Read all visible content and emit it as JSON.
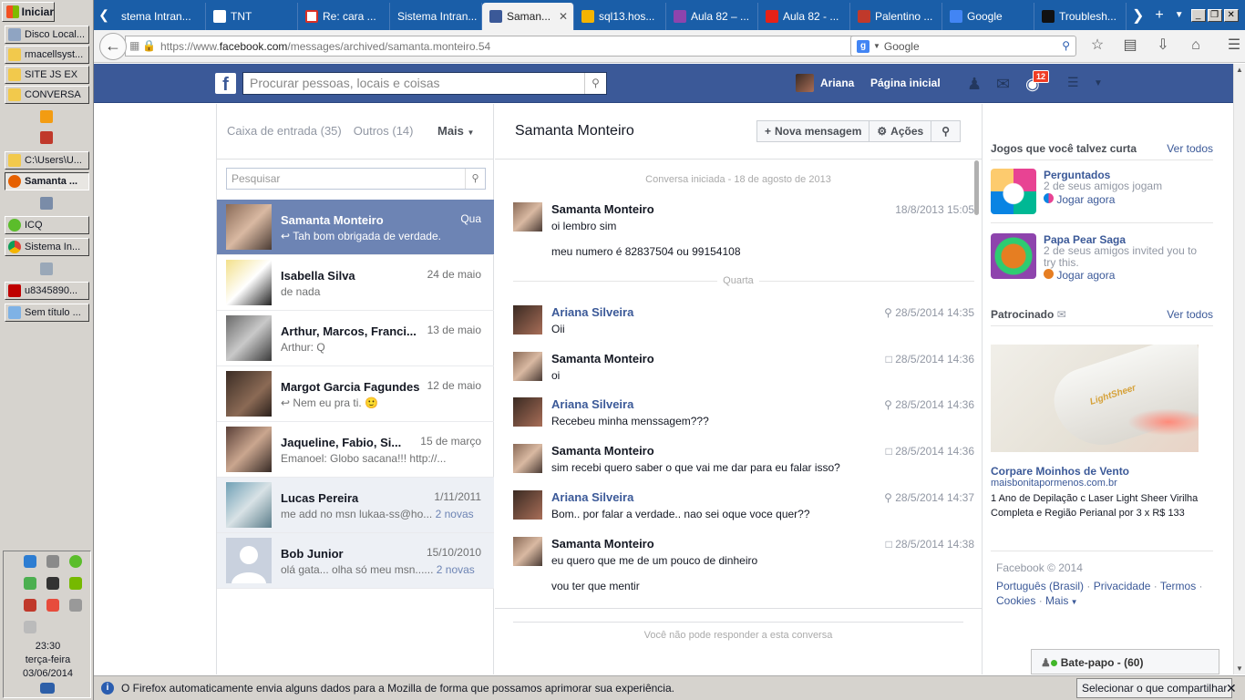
{
  "taskbar": {
    "start_label": "Iniciar",
    "items": [
      {
        "label": "Disco Local..."
      },
      {
        "label": "rmacellsyst..."
      },
      {
        "label": "SITE JS EX"
      },
      {
        "label": "CONVERSA"
      },
      {
        "label": "C:\\Users\\U..."
      },
      {
        "label": "Samanta ..."
      },
      {
        "label": "ICQ"
      },
      {
        "label": "Sistema In..."
      },
      {
        "label": "u8345890..."
      },
      {
        "label": "Sem título ..."
      }
    ],
    "clock_time": "23:30",
    "clock_day": "terça-feira",
    "clock_date": "03/06/2014"
  },
  "browser": {
    "tabs": [
      {
        "label": "stema Intran..."
      },
      {
        "label": "TNT"
      },
      {
        "label": "Re: cara ..."
      },
      {
        "label": "Sistema Intran..."
      },
      {
        "label": "Saman..."
      },
      {
        "label": "sql13.hos..."
      },
      {
        "label": "Aula 82 – ..."
      },
      {
        "label": "Aula 82 - ..."
      },
      {
        "label": "Palentino ..."
      },
      {
        "label": "Google"
      },
      {
        "label": "Troublesh..."
      }
    ],
    "url_prefix": "https://www.",
    "url_domain": "facebook.com",
    "url_path": "/messages/archived/samanta.monteiro.54",
    "search_placeholder": "Google"
  },
  "fb_header": {
    "search_placeholder": "Procurar pessoas, locais e coisas",
    "user_name": "Ariana",
    "home_label": "Página inicial",
    "notif_count": "12"
  },
  "inbox": {
    "inbox_label": "Caixa de entrada (35)",
    "others_label": "Outros (14)",
    "more_label": "Mais",
    "search_placeholder": "Pesquisar",
    "threads": [
      {
        "name": "Samanta Monteiro",
        "date": "Qua",
        "preview": "Tah bom obrigada de verdade."
      },
      {
        "name": "Isabella Silva",
        "date": "24 de maio",
        "preview": "de nada"
      },
      {
        "name": "Arthur, Marcos, Franci...",
        "date": "13 de maio",
        "preview": "Arthur: Q"
      },
      {
        "name": "Margot Garcia Fagundes",
        "date": "12 de maio",
        "preview": "Nem eu pra ti. 🙂"
      },
      {
        "name": "Jaqueline, Fabio, Si...",
        "date": "15 de março",
        "preview": "Emanoel: Globo sacana!!! http://..."
      },
      {
        "name": "Lucas Pereira",
        "date": "1/11/2011",
        "preview": "me add no msn lukaa-ss@ho...",
        "new": "2 novas"
      },
      {
        "name": "Bob Junior",
        "date": "15/10/2010",
        "preview": "olá gata... olha só meu msn......",
        "new": "2 novas"
      }
    ]
  },
  "conversation": {
    "title": "Samanta Monteiro",
    "new_message_label": "Nova mensagem",
    "actions_label": "Ações",
    "started": "Conversa iniciada - 18 de agosto de 2013",
    "day_separator": "Quarta",
    "messages": [
      {
        "sender": "Samanta Monteiro",
        "time": "18/8/2013 15:05",
        "lines": [
          "oi lembro sim",
          "meu numero é 82837504 ou 99154108"
        ]
      },
      {
        "sender": "Ariana Silveira",
        "time": "28/5/2014 14:35",
        "lines": [
          "Oii"
        ]
      },
      {
        "sender": "Samanta Monteiro",
        "time": "28/5/2014 14:36",
        "lines": [
          "oi"
        ]
      },
      {
        "sender": "Ariana Silveira",
        "time": "28/5/2014 14:36",
        "lines": [
          "Recebeu minha menssagem???"
        ]
      },
      {
        "sender": "Samanta Monteiro",
        "time": "28/5/2014 14:36",
        "lines": [
          "sim recebi quero saber o que vai me dar para eu falar isso?"
        ]
      },
      {
        "sender": "Ariana Silveira",
        "time": "28/5/2014 14:37",
        "lines": [
          "Bom.. por falar a verdade.. nao sei oque voce quer??"
        ]
      },
      {
        "sender": "Samanta Monteiro",
        "time": "28/5/2014 14:38",
        "lines": [
          "eu quero que me de um pouco de dinheiro",
          "vou ter que mentir"
        ]
      }
    ],
    "no_reply": "Você não pode responder a esta conversa"
  },
  "right": {
    "games_title": "Jogos que você talvez curta",
    "see_all": "Ver todos",
    "games": [
      {
        "name": "Perguntados",
        "sub": "2 de seus amigos jogam",
        "play": "Jogar agora"
      },
      {
        "name": "Papa Pear Saga",
        "sub": "2 de seus amigos invited you to try this.",
        "play": "Jogar agora"
      }
    ],
    "sponsored_title": "Patrocinado",
    "ad_brand": "LightSheer",
    "ad_title": "Corpare Moinhos de Vento",
    "ad_url": "maisbonitapormenos.com.br",
    "ad_desc": "1 Ano de Depilação c Laser Light Sheer Virilha Completa e Região Perianal por 3 x R$ 133",
    "footer_copy": "Facebook © 2014",
    "footer_links": [
      "Português (Brasil)",
      "Privacidade",
      "Termos",
      "Cookies",
      "Mais"
    ]
  },
  "chat": {
    "label": "Bate-papo - (60)"
  },
  "notification": {
    "text": "O Firefox automaticamente envia alguns dados para a Mozilla de forma que possamos aprimorar sua experiência.",
    "share_label": "Selecionar o que compartilhar"
  }
}
